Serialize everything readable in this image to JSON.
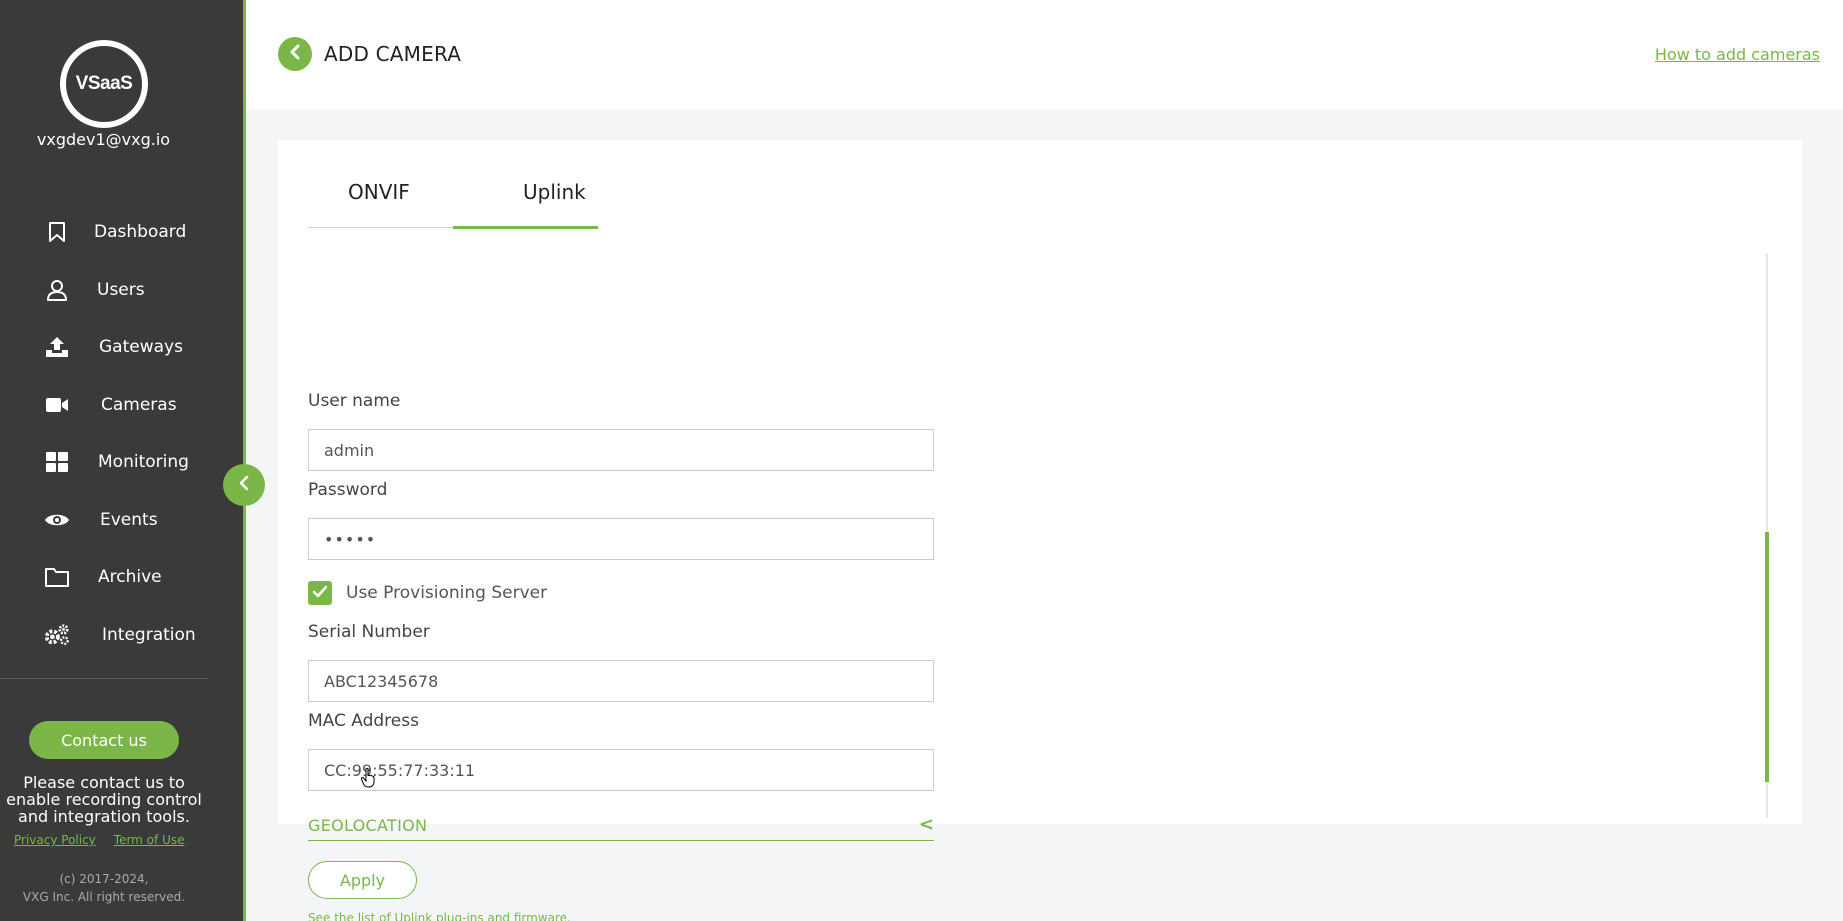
{
  "sidebar": {
    "logo_text": "VSaaS",
    "user_email": "vxgdev1@vxg.io",
    "nav_items": [
      {
        "label": "Dashboard",
        "icon": "bookmark-icon"
      },
      {
        "label": "Users",
        "icon": "user-icon"
      },
      {
        "label": "Gateways",
        "icon": "upload-icon"
      },
      {
        "label": "Cameras",
        "icon": "video-camera-icon"
      },
      {
        "label": "Monitoring",
        "icon": "grid-icon"
      },
      {
        "label": "Events",
        "icon": "eye-icon"
      },
      {
        "label": "Archive",
        "icon": "folder-icon"
      },
      {
        "label": "Integration",
        "icon": "gears-icon"
      }
    ],
    "contact_button": "Contact us",
    "contact_text": "Please contact us to enable recording control and integration tools.",
    "privacy_link": "Privacy Policy",
    "terms_link": "Term of Use",
    "copyright_line1": "(c) 2017-2024,",
    "copyright_line2": "VXG Inc. All right reserved."
  },
  "header": {
    "title": "ADD CAMERA",
    "help_link": "How to add cameras"
  },
  "tabs": [
    {
      "label": "ONVIF",
      "active": false
    },
    {
      "label": "Uplink",
      "active": true
    }
  ],
  "form": {
    "username_label": "User name",
    "username_value": "admin",
    "password_label": "Password",
    "password_value": "•••••",
    "provisioning_label": "Use Provisioning Server",
    "provisioning_checked": true,
    "serial_label": "Serial Number",
    "serial_value": "ABC12345678",
    "mac_label": "MAC Address",
    "mac_value": "CC:99:55:77:33:11",
    "geolocation_label": "GEOLOCATION",
    "geolocation_toggle": "<",
    "apply_button": "Apply",
    "plugins_link": "See the list of Uplink plug-ins and firmware."
  },
  "colors": {
    "accent": "#7ab648",
    "sidebar_bg": "#3a3a3a",
    "page_bg": "#f4f5f7"
  }
}
